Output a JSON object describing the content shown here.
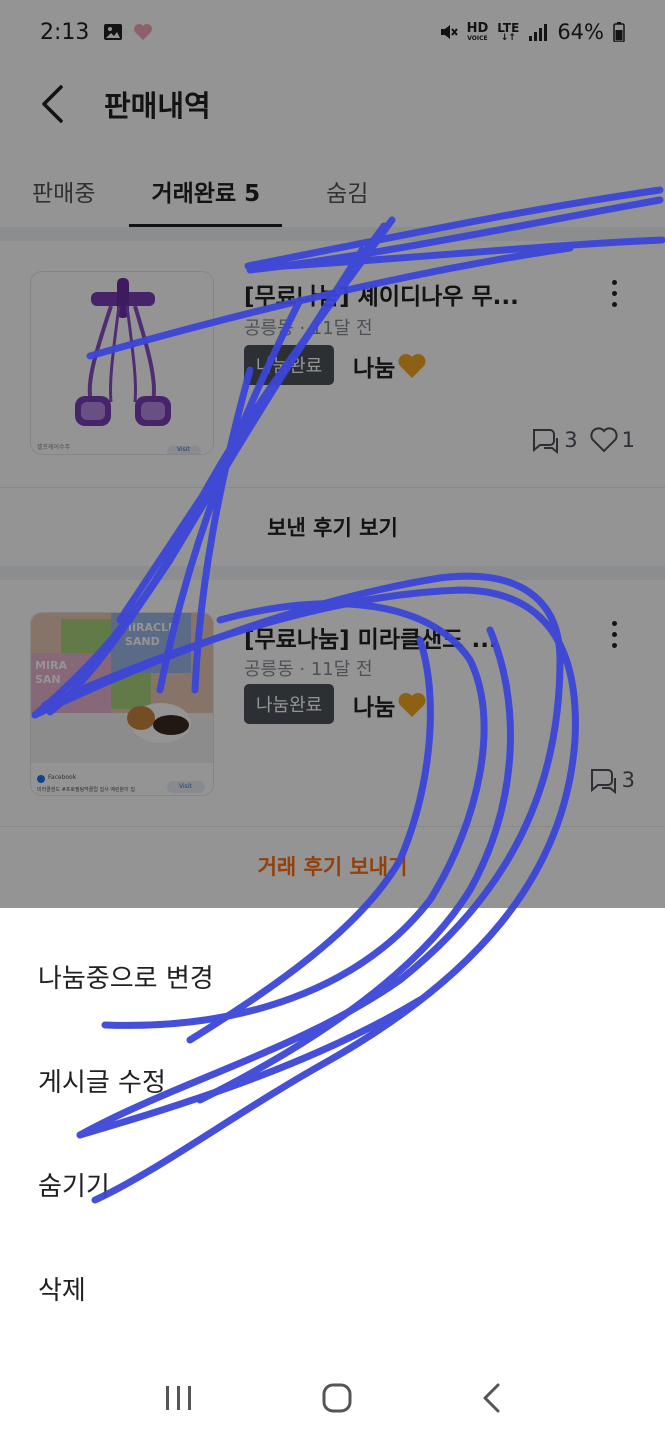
{
  "status_bar": {
    "time": "2:13",
    "battery": "64%",
    "network_hd": "HD",
    "network_voice": "VOICE",
    "network_lte": "LTE"
  },
  "header": {
    "title": "판매내역"
  },
  "tabs": [
    {
      "label": "판매중"
    },
    {
      "label": "거래완료 5"
    },
    {
      "label": "숨김"
    }
  ],
  "items": [
    {
      "title": "[무료나눔] 셰이디나우 무...",
      "meta": "공릉동 · 11달 전",
      "status": "나눔완료",
      "price": "나눔",
      "chat_count": "3",
      "like_count": "1",
      "review_link": "보낸 후기 보기",
      "thumb_caption": "셀프케어수주",
      "thumb_button": "Visit"
    },
    {
      "title": "[무료나눔] 미라클샌드 ...",
      "meta": "공릉동 · 11달 전",
      "status": "나눔완료",
      "price": "나눔",
      "chat_count": "3",
      "review_link": "거래 후기 보내기",
      "thumb_brand_top": "MIRACLE",
      "thumb_brand_bottom": "SAND",
      "thumb_brand_left": "MIRA",
      "thumb_brand_left2": "SAN",
      "thumb_source": "Facebook",
      "thumb_caption": "미라클샌드 #프로필팅먹클럽 집사 예린분의 집",
      "thumb_button": "Visit"
    }
  ],
  "sheet": {
    "options": [
      {
        "label": "나눔중으로 변경"
      },
      {
        "label": "게시글 수정"
      },
      {
        "label": "숨기기"
      },
      {
        "label": "삭제"
      }
    ]
  },
  "colors": {
    "accent": "#ff6f0f",
    "badge": "#4d5159",
    "scribble": "#3c46d8"
  }
}
